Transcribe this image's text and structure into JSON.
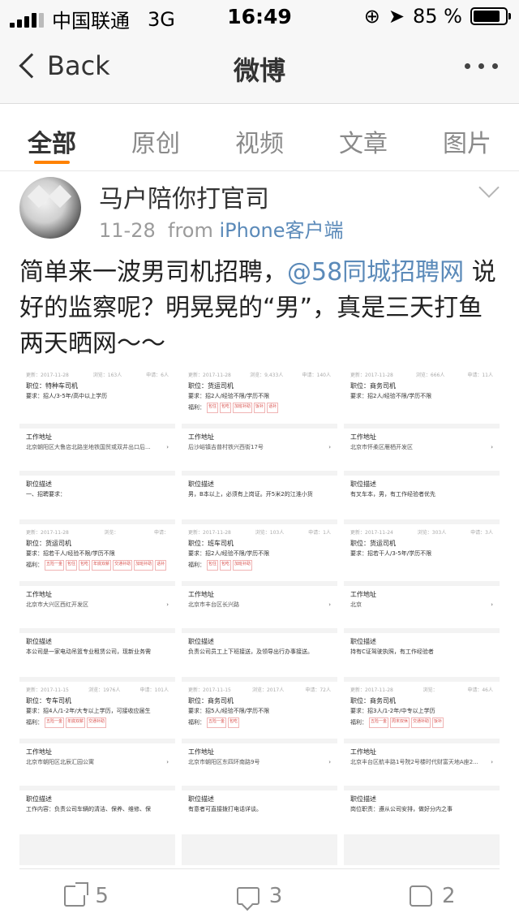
{
  "status": {
    "carrier": "中国联通",
    "network": "3G",
    "time": "16:49",
    "battery": "85 %",
    "battery_level": 0.85
  },
  "nav": {
    "back_label": "Back",
    "title": "微博"
  },
  "tabs": [
    {
      "label": "全部",
      "active": true
    },
    {
      "label": "原创"
    },
    {
      "label": "视频"
    },
    {
      "label": "文章"
    },
    {
      "label": "图片"
    }
  ],
  "post": {
    "author": "马户陪你打官司",
    "date": "11-28",
    "from_label": "from",
    "source": "iPhone客户端",
    "text_before": "简单来一波男司机招聘，",
    "mention": "@58同城招聘网",
    "text_after": " 说好的监察呢？明晃晃的“男”，真是三天打鱼 两天晒网～～"
  },
  "screens": [
    {
      "jobs": [
        {
          "stat": [
            "更新：2017-11-28",
            "浏览：163人",
            "申请：6人"
          ],
          "position": "职位：特种车司机",
          "req": "要求：招人/3-5年/高中以上学历",
          "tags": [],
          "address_title": "工作地址",
          "address": "北京朝阳区大鲁店北路坐地铁国贸或双井出口后...",
          "desc_title": "职位描述",
          "desc": "一、招聘要求："
        },
        {
          "stat": [
            "更新：2017-11-28",
            "浏览：",
            "申请："
          ],
          "position": "职位：货运司机",
          "req": "要求：招若干人/经验不限/学历不限",
          "tags": [
            "五险一金",
            "包住",
            "包吃",
            "年底双薪",
            "交通补助",
            "加班补助",
            "话补"
          ],
          "address_title": "工作地址",
          "address": "北京市大兴区西红开发区",
          "desc_title": "职位描述",
          "desc": "本公司是一家电动吊篮专业租赁公司，现新业务需"
        },
        {
          "stat": [
            "更新：2017-11-15",
            "浏览：1976人",
            "申请：101人"
          ],
          "position": "职位：专车司机",
          "req": "要求：招4人/1-2年/大专以上学历，可接收应届生",
          "tags": [
            "五险一金",
            "年底双薪",
            "交通补助"
          ],
          "address_title": "工作地址",
          "address": "北京市朝阳区北辰汇园公寓",
          "desc_title": "职位描述",
          "desc": "工作内容：负责公司车辆的清洁、保养、维修、保"
        }
      ]
    },
    {
      "jobs": [
        {
          "stat": [
            "更新：2017-11-28",
            "浏览：9,433人",
            "申请：140人"
          ],
          "position": "职位：货运司机",
          "req": "要求：招2人/经验不限/学历不限",
          "tags": [
            "包住",
            "包吃",
            "加班补助",
            "饭补",
            "话补"
          ],
          "address_title": "工作地址",
          "address": "后沙峪镇吉普村铁兴西街17号",
          "desc_title": "职位描述",
          "desc": "男，B本以上，必须有上岗证。开5米2的江淮小货"
        },
        {
          "stat": [
            "更新：2017-11-28",
            "浏览：103人",
            "申请：1人"
          ],
          "position": "职位：班车司机",
          "req": "要求：招2人/经验不限/学历不限",
          "tags": [
            "包住",
            "包吃",
            "加班补助"
          ],
          "address_title": "工作地址",
          "address": "北京市丰台区长兴路",
          "desc_title": "职位描述",
          "desc": "负责公司员工上下班接送，及领导出行办事接送。"
        },
        {
          "stat": [
            "更新：2017-11-15",
            "浏览：2017人",
            "申请：72人"
          ],
          "position": "职位：商务司机",
          "req": "要求：招5人/经验不限/学历不限",
          "tags": [
            "五险一金",
            "包吃"
          ],
          "address_title": "工作地址",
          "address": "北京市朝阳区东四环南路9号",
          "desc_title": "职位描述",
          "desc": "有意者可直接拨打电话详谈。"
        }
      ]
    },
    {
      "jobs": [
        {
          "stat": [
            "更新：2017-11-28",
            "浏览：666人",
            "申请：11人"
          ],
          "position": "职位：商务司机",
          "req": "要求：招2人/经验不限/学历不限",
          "tags": [],
          "address_title": "工作地址",
          "address": "北京市怀柔区雁栖开发区",
          "desc_title": "职位描述",
          "desc": "有叉车本，男，有工作经验者优先"
        },
        {
          "stat": [
            "更新：2017-11-24",
            "浏览：303人",
            "申请：3人"
          ],
          "position": "职位：货运司机",
          "req": "要求：招若干人/3-5年/学历不限",
          "tags": [],
          "address_title": "工作地址",
          "address": "北京",
          "desc_title": "职位描述",
          "desc": "持有C证驾驶执照，有工作经验者"
        },
        {
          "stat": [
            "更新：2017-11-28",
            "浏览：",
            "申请：46人"
          ],
          "position": "职位：商务司机",
          "req": "要求：招3人/1-2年/中专以上学历",
          "tags": [
            "五险一金",
            "周末双休",
            "交通补助",
            "饭补"
          ],
          "address_title": "工作地址",
          "address": "北京丰台区航丰路1号院2号楼时代财富天地A座2...",
          "desc_title": "职位描述",
          "desc": "岗位职责：遵从公司安排，做好分内之事"
        }
      ]
    }
  ],
  "actions": {
    "share_count": "5",
    "comment_count": "3",
    "like_count": "2"
  }
}
